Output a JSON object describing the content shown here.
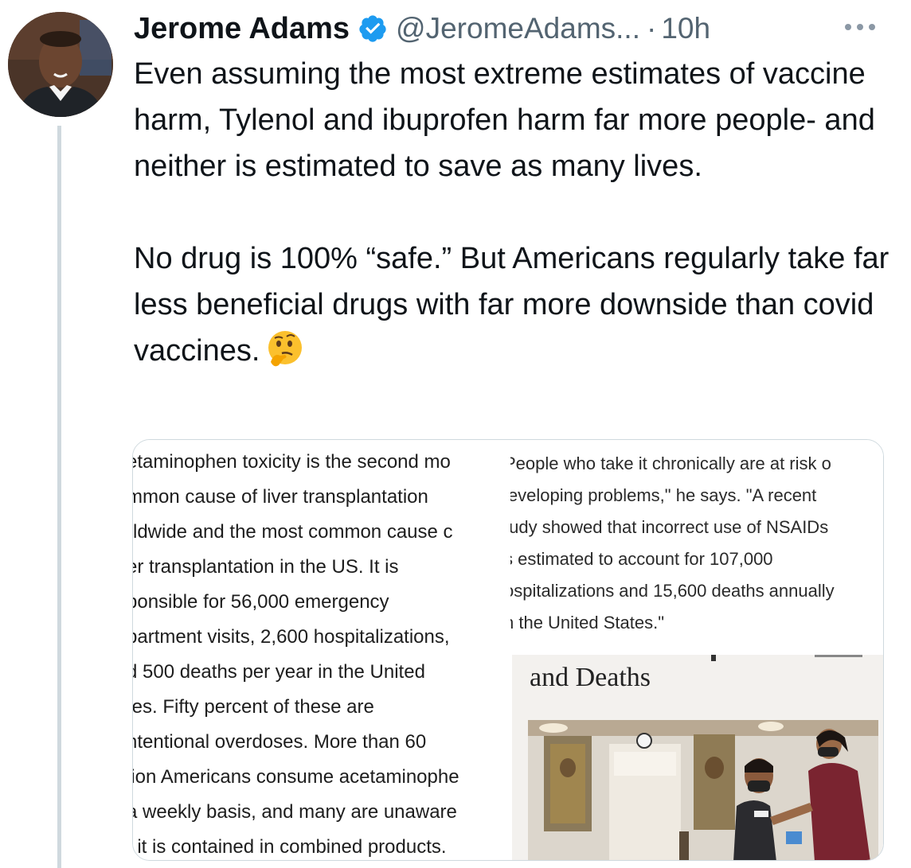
{
  "author": {
    "name": "Jerome Adams",
    "handle": "@JeromeAdams...",
    "separator": "·",
    "time": "10h"
  },
  "tweet": {
    "paragraph1": "Even assuming the most extreme estimates of vaccine harm, Tylenol and ibuprofen harm far more people- and neither is estimated to save as many lives.",
    "paragraph2": "No drug is 100% “safe.”  But Americans regularly take far less beneficial drugs with far more downside than covid vaccines."
  },
  "media": {
    "left_lines": [
      "etaminophen toxicity is the second mo",
      "mmon cause of liver transplantation",
      "rldwide and the most common cause c",
      "er transplantation in the US. It is",
      "ponsible for 56,000 emergency",
      "partment visits, 2,600 hospitalizations,",
      "d 500 deaths per year in the United",
      "tes. Fifty percent of these are",
      "ntentional overdoses. More than 60",
      "lion Americans consume acetaminophe",
      "a weekly basis, and many are unaware",
      "t it is contained in combined products."
    ],
    "right_lines": [
      "People who take it chronically are at risk o",
      "leveloping problems,\" he says. \"A recent",
      "tudy showed that incorrect use of NSAIDs",
      "s estimated to account for 107,000",
      "ospitalizations and 15,600 deaths annually",
      "n the United States.\""
    ],
    "article_title": "and Deaths"
  },
  "icons": {
    "verified": "verified-badge-icon",
    "more": "more-options-icon",
    "emoji": "thinking-face-emoji"
  },
  "colors": {
    "verified_blue": "#1d9bf0",
    "secondary_text": "#536471",
    "thread_line": "#cfd9de"
  }
}
